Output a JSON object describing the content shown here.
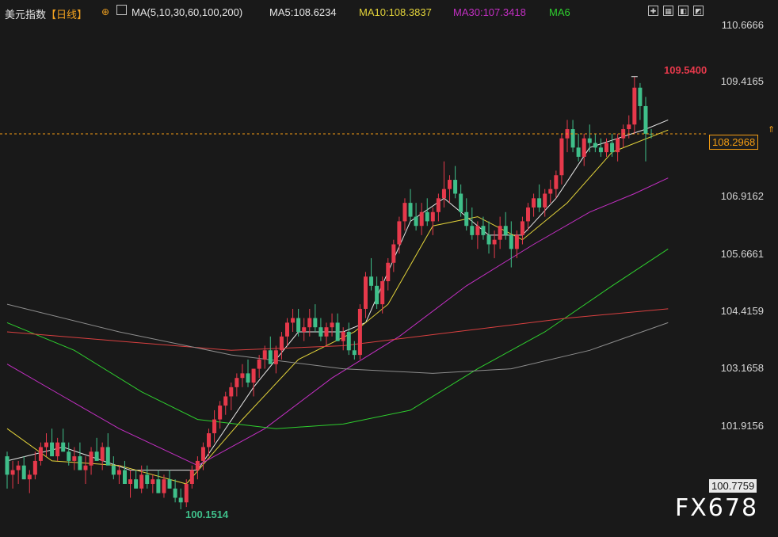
{
  "header": {
    "instrument": "美元指数",
    "period": "【日线】",
    "ma_spec": "MA(5,10,30,60,100,200)",
    "ma5": "MA5:108.6234",
    "ma10": "MA10:108.3837",
    "ma30": "MA30:107.3418",
    "ma60": "MA6"
  },
  "icons": [
    "expand-icon",
    "grid-icon",
    "panel-icon",
    "chart-icon"
  ],
  "watermark": "FX678",
  "colors": {
    "background": "#191919",
    "up": "#e6394b",
    "down": "#3fbf8a",
    "ma5": "#e8e8e8",
    "ma10": "#e4d43a",
    "ma30": "#c42fc4",
    "ma60": "#2ecf2e",
    "ma100": "#d94040",
    "ma200": "#8d8d8d",
    "current_price_line": "#f39c12"
  },
  "chart_data": {
    "type": "candlestick",
    "title": "美元指数【日线】",
    "ylim": [
      100.15,
      110.67
    ],
    "y_ticks": [
      "110.6666",
      "109.4165",
      "106.9162",
      "105.6661",
      "104.4159",
      "103.1658",
      "101.9156"
    ],
    "current_price": "108.2968",
    "last_low_label": "100.7759",
    "max_annotation": {
      "label": "109.5400",
      "value": 109.54
    },
    "min_annotation": {
      "label": "100.1514",
      "value": 100.1514
    },
    "candles": [
      [
        101.3,
        101.4,
        100.6,
        100.9
      ],
      [
        100.9,
        101.2,
        100.6,
        101.0
      ],
      [
        101.0,
        101.2,
        100.7,
        101.1
      ],
      [
        101.1,
        101.3,
        100.8,
        100.8
      ],
      [
        100.8,
        101.0,
        100.5,
        100.9
      ],
      [
        100.9,
        101.4,
        100.8,
        101.2
      ],
      [
        101.2,
        101.6,
        101.1,
        101.5
      ],
      [
        101.5,
        101.8,
        101.3,
        101.6
      ],
      [
        101.6,
        101.9,
        101.4,
        101.3
      ],
      [
        101.3,
        101.7,
        101.2,
        101.6
      ],
      [
        101.6,
        101.9,
        101.4,
        101.4
      ],
      [
        101.4,
        101.6,
        101.1,
        101.2
      ],
      [
        101.2,
        101.5,
        101.0,
        101.3
      ],
      [
        101.3,
        101.6,
        101.1,
        101.0
      ],
      [
        101.0,
        101.3,
        100.7,
        101.1
      ],
      [
        101.1,
        101.5,
        100.9,
        101.4
      ],
      [
        101.4,
        101.7,
        101.2,
        101.2
      ],
      [
        101.2,
        101.6,
        101.0,
        101.5
      ],
      [
        101.5,
        101.8,
        101.3,
        101.1
      ],
      [
        101.1,
        101.3,
        100.8,
        100.9
      ],
      [
        100.9,
        101.1,
        100.7,
        101.0
      ],
      [
        101.0,
        101.2,
        100.8,
        100.7
      ],
      [
        100.7,
        101.0,
        100.4,
        100.8
      ],
      [
        100.8,
        101.0,
        100.6,
        100.6
      ],
      [
        100.6,
        101.1,
        100.5,
        100.9
      ],
      [
        100.9,
        101.1,
        100.6,
        100.7
      ],
      [
        100.7,
        100.9,
        100.5,
        100.8
      ],
      [
        100.8,
        101.0,
        100.5,
        100.5
      ],
      [
        100.5,
        100.9,
        100.4,
        100.8
      ],
      [
        100.8,
        101.0,
        100.6,
        100.6
      ],
      [
        100.6,
        100.8,
        100.3,
        100.4
      ],
      [
        100.4,
        100.6,
        100.15,
        100.3
      ],
      [
        100.3,
        100.8,
        100.2,
        100.7
      ],
      [
        100.7,
        101.1,
        100.6,
        101.0
      ],
      [
        101.0,
        101.3,
        100.8,
        101.2
      ],
      [
        101.2,
        101.6,
        101.0,
        101.5
      ],
      [
        101.5,
        101.9,
        101.3,
        101.8
      ],
      [
        101.8,
        102.3,
        101.6,
        102.1
      ],
      [
        102.1,
        102.5,
        101.9,
        102.4
      ],
      [
        102.4,
        102.7,
        102.2,
        102.6
      ],
      [
        102.6,
        102.9,
        102.3,
        102.8
      ],
      [
        102.8,
        103.1,
        102.6,
        103.0
      ],
      [
        103.0,
        103.3,
        102.8,
        103.1
      ],
      [
        103.1,
        103.4,
        102.8,
        102.9
      ],
      [
        102.9,
        103.2,
        102.6,
        103.2
      ],
      [
        103.2,
        103.5,
        103.0,
        103.4
      ],
      [
        103.4,
        103.7,
        103.2,
        103.6
      ],
      [
        103.6,
        103.9,
        103.4,
        103.3
      ],
      [
        103.3,
        103.7,
        103.1,
        103.6
      ],
      [
        103.6,
        104.0,
        103.4,
        103.9
      ],
      [
        103.9,
        104.3,
        103.7,
        104.2
      ],
      [
        104.2,
        104.5,
        104.0,
        104.3
      ],
      [
        104.3,
        104.5,
        103.9,
        104.0
      ],
      [
        104.0,
        104.3,
        103.8,
        104.1
      ],
      [
        104.1,
        104.5,
        103.9,
        104.3
      ],
      [
        104.3,
        104.6,
        104.0,
        104.1
      ],
      [
        104.1,
        104.3,
        103.8,
        103.9
      ],
      [
        103.9,
        104.2,
        103.7,
        104.1
      ],
      [
        104.1,
        104.4,
        103.9,
        104.2
      ],
      [
        104.2,
        104.4,
        103.8,
        103.8
      ],
      [
        103.8,
        104.1,
        103.6,
        104.0
      ],
      [
        104.0,
        104.2,
        103.5,
        103.6
      ],
      [
        103.6,
        103.8,
        103.4,
        103.5
      ],
      [
        103.5,
        104.6,
        103.4,
        104.5
      ],
      [
        104.5,
        105.3,
        104.3,
        105.2
      ],
      [
        105.2,
        105.6,
        104.9,
        105.0
      ],
      [
        105.0,
        105.2,
        104.5,
        104.6
      ],
      [
        104.6,
        105.2,
        104.4,
        105.1
      ],
      [
        105.1,
        105.6,
        104.9,
        105.5
      ],
      [
        105.5,
        106.0,
        105.3,
        105.9
      ],
      [
        105.9,
        106.5,
        105.7,
        106.4
      ],
      [
        106.4,
        106.9,
        106.2,
        106.8
      ],
      [
        106.8,
        107.1,
        106.4,
        106.5
      ],
      [
        106.5,
        106.8,
        106.2,
        106.3
      ],
      [
        106.3,
        106.8,
        106.1,
        106.6
      ],
      [
        106.6,
        106.9,
        106.3,
        106.4
      ],
      [
        106.4,
        106.7,
        106.1,
        106.6
      ],
      [
        106.6,
        107.0,
        106.4,
        106.9
      ],
      [
        106.9,
        107.7,
        106.7,
        107.1
      ],
      [
        107.1,
        107.4,
        106.8,
        107.3
      ],
      [
        107.3,
        107.6,
        106.9,
        107.0
      ],
      [
        107.0,
        107.2,
        106.5,
        106.6
      ],
      [
        106.6,
        106.9,
        106.2,
        106.3
      ],
      [
        106.3,
        106.7,
        106.0,
        106.1
      ],
      [
        106.1,
        106.4,
        105.8,
        106.3
      ],
      [
        106.3,
        106.5,
        106.0,
        106.1
      ],
      [
        106.1,
        106.4,
        105.7,
        105.9
      ],
      [
        105.9,
        106.2,
        105.6,
        106.0
      ],
      [
        106.0,
        106.5,
        105.8,
        106.3
      ],
      [
        106.3,
        106.6,
        106.0,
        106.1
      ],
      [
        106.1,
        106.4,
        105.4,
        105.8
      ],
      [
        105.8,
        106.2,
        105.6,
        106.1
      ],
      [
        106.1,
        106.5,
        105.9,
        106.4
      ],
      [
        106.4,
        106.8,
        106.2,
        106.7
      ],
      [
        106.7,
        107.0,
        106.5,
        106.9
      ],
      [
        106.9,
        107.2,
        106.6,
        106.7
      ],
      [
        106.7,
        107.1,
        106.5,
        107.0
      ],
      [
        107.0,
        107.3,
        106.8,
        107.1
      ],
      [
        107.1,
        107.5,
        106.9,
        107.4
      ],
      [
        107.4,
        108.3,
        107.2,
        108.2
      ],
      [
        108.2,
        108.6,
        107.9,
        108.4
      ],
      [
        108.4,
        108.6,
        107.9,
        108.0
      ],
      [
        108.0,
        108.3,
        107.7,
        107.8
      ],
      [
        107.8,
        108.3,
        107.6,
        108.2
      ],
      [
        108.2,
        108.5,
        107.9,
        108.1
      ],
      [
        108.1,
        108.3,
        107.9,
        108.0
      ],
      [
        108.0,
        108.2,
        107.8,
        107.9
      ],
      [
        107.9,
        108.2,
        107.8,
        108.1
      ],
      [
        108.1,
        108.3,
        107.8,
        107.9
      ],
      [
        107.9,
        108.3,
        107.7,
        108.2
      ],
      [
        108.2,
        108.5,
        108.0,
        108.4
      ],
      [
        108.4,
        108.7,
        108.2,
        108.5
      ],
      [
        108.5,
        109.54,
        108.3,
        109.3
      ],
      [
        109.3,
        109.4,
        108.6,
        108.9
      ],
      [
        108.9,
        109.1,
        107.7,
        108.3
      ],
      [
        108.3,
        108.4,
        108.2,
        108.29
      ]
    ],
    "ma_series": [
      {
        "name": "MA5",
        "values": [
          [
            0,
            101.2
          ],
          [
            10,
            101.5
          ],
          [
            22,
            101.0
          ],
          [
            34,
            101.0
          ],
          [
            44,
            102.8
          ],
          [
            52,
            104.0
          ],
          [
            60,
            104.0
          ],
          [
            64,
            104.2
          ],
          [
            72,
            106.4
          ],
          [
            78,
            106.9
          ],
          [
            86,
            106.1
          ],
          [
            92,
            106.1
          ],
          [
            98,
            106.9
          ],
          [
            104,
            108.0
          ],
          [
            114,
            108.4
          ],
          [
            118,
            108.6
          ]
        ]
      },
      {
        "name": "MA10",
        "values": [
          [
            0,
            101.9
          ],
          [
            8,
            101.2
          ],
          [
            20,
            101.1
          ],
          [
            32,
            100.7
          ],
          [
            42,
            102.1
          ],
          [
            52,
            103.4
          ],
          [
            62,
            104.0
          ],
          [
            68,
            104.6
          ],
          [
            76,
            106.3
          ],
          [
            84,
            106.5
          ],
          [
            92,
            106.0
          ],
          [
            100,
            106.8
          ],
          [
            108,
            107.9
          ],
          [
            118,
            108.38
          ]
        ]
      },
      {
        "name": "MA30",
        "values": [
          [
            0,
            103.3
          ],
          [
            10,
            102.6
          ],
          [
            20,
            101.9
          ],
          [
            34,
            101.1
          ],
          [
            46,
            101.9
          ],
          [
            58,
            103.0
          ],
          [
            70,
            103.9
          ],
          [
            82,
            105.0
          ],
          [
            94,
            105.9
          ],
          [
            104,
            106.6
          ],
          [
            112,
            107.0
          ],
          [
            118,
            107.34
          ]
        ]
      },
      {
        "name": "MA60",
        "values": [
          [
            0,
            104.2
          ],
          [
            12,
            103.6
          ],
          [
            24,
            102.7
          ],
          [
            34,
            102.1
          ],
          [
            48,
            101.9
          ],
          [
            60,
            102.0
          ],
          [
            72,
            102.3
          ],
          [
            84,
            103.2
          ],
          [
            96,
            104.0
          ],
          [
            108,
            105.0
          ],
          [
            118,
            105.8
          ]
        ]
      },
      {
        "name": "MA100",
        "values": [
          [
            0,
            104.0
          ],
          [
            20,
            103.8
          ],
          [
            40,
            103.6
          ],
          [
            60,
            103.7
          ],
          [
            80,
            104.0
          ],
          [
            100,
            104.3
          ],
          [
            118,
            104.5
          ]
        ]
      },
      {
        "name": "MA200",
        "values": [
          [
            0,
            104.6
          ],
          [
            20,
            104.0
          ],
          [
            40,
            103.5
          ],
          [
            60,
            103.2
          ],
          [
            76,
            103.1
          ],
          [
            90,
            103.2
          ],
          [
            104,
            103.6
          ],
          [
            118,
            104.2
          ]
        ]
      }
    ]
  }
}
